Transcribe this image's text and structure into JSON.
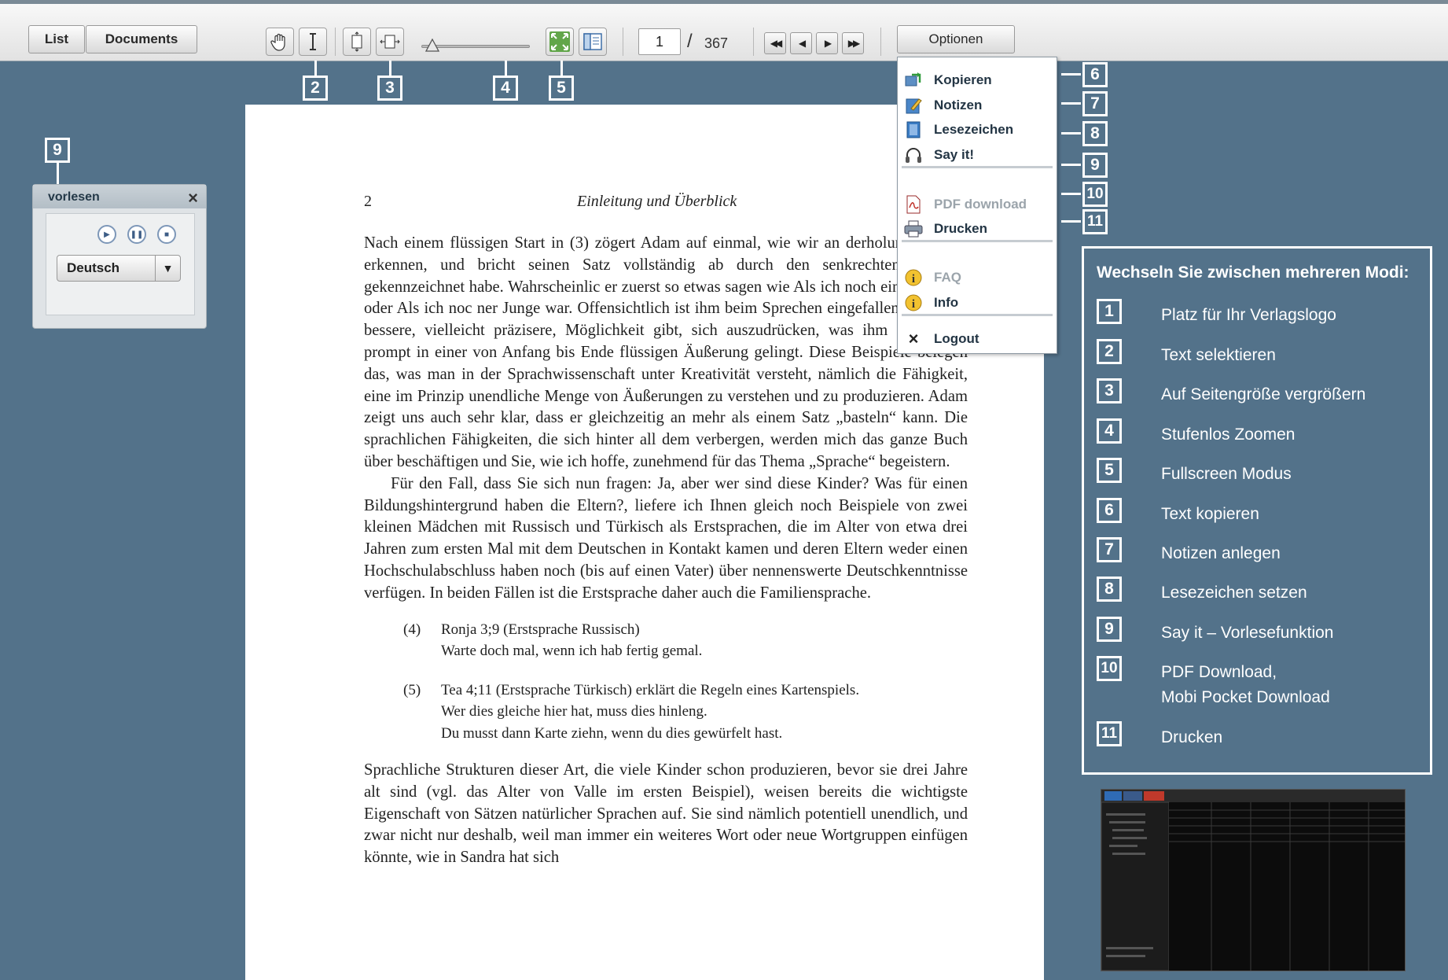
{
  "toolbar": {
    "list_label": "List",
    "documents_label": "Documents",
    "current_page": "1",
    "page_separator": "/",
    "total_pages": "367",
    "options_label": "Optionen"
  },
  "callouts": [
    "2",
    "3",
    "4",
    "5",
    "6",
    "7",
    "8",
    "9",
    "10",
    "11",
    "9"
  ],
  "vorlesen": {
    "title": "vorlesen",
    "language": "Deutsch"
  },
  "menu": {
    "items": [
      {
        "label": "Kopieren",
        "icon": "copy-icon"
      },
      {
        "label": "Notizen",
        "icon": "notes-icon"
      },
      {
        "label": "Lesezeichen",
        "icon": "bookmark-icon"
      },
      {
        "label": "Say it!",
        "icon": "headphones-icon"
      },
      {
        "label": "PDF download",
        "icon": "pdf-icon",
        "disabled": true
      },
      {
        "label": "Drucken",
        "icon": "print-icon"
      },
      {
        "label": "FAQ",
        "icon": "info-icon",
        "disabled": true
      },
      {
        "label": "Info",
        "icon": "info-icon"
      },
      {
        "label": "Logout",
        "icon": "close-icon"
      }
    ]
  },
  "document": {
    "page_number": "2",
    "running_head": "Einleitung und Überblick",
    "para1": "Nach einem flüssigen Start in (3) zögert Adam auf einmal, wie wir an derholung von ein erkennen, und bricht seinen Satz vollständig ab durch den senkrechten Strich | gekennzeichnet habe. Wahrscheinlic er zuerst so etwas sagen wie Als ich noch ein Baby war oder Als ich noc ner Junge war. Offensichtlich ist ihm beim Sprechen eingefallen, dass eine bessere, vielleicht präzisere, Möglichkeit gibt, sich auszudrücken, was ihm dann auch prompt in einer von Anfang bis Ende flüssigen Äußerung gelingt. Diese Beispiele belegen das, was man in der Sprachwissenschaft unter Kreativität versteht, nämlich die Fähigkeit, eine im Prinzip unendliche Menge von Äußerungen zu verstehen und zu produzieren. Adam zeigt uns auch sehr klar, dass er gleichzeitig an mehr als einem Satz „basteln“ kann. Die sprachlichen Fähigkeiten, die sich hinter all dem verbergen, werden mich das ganze Buch über beschäftigen und Sie, wie ich hoffe, zunehmend für das Thema „Sprache“ begeistern.",
    "para2": "Für den Fall, dass Sie sich nun fragen: Ja, aber wer sind diese Kinder? Was für einen Bildungshintergrund haben die Eltern?, liefere ich Ihnen gleich noch Beispiele von zwei kleinen Mädchen mit Russisch und Türkisch als Erstsprachen, die im Alter von etwa drei Jahren zum ersten Mal mit dem Deutschen in Kontakt kamen und deren Eltern weder einen Hochschulabschluss haben noch (bis auf einen Vater) über nennenswerte Deutschkenntnisse verfügen. In beiden Fällen ist die Erstsprache daher auch die Familiensprache.",
    "ex4_num": "(4)",
    "ex4_head": "Ronja 3;9 (Erstsprache Russisch)",
    "ex4_line1": "Warte doch mal, wenn ich hab fertig gemal.",
    "ex5_num": "(5)",
    "ex5_head": "Tea 4;11 (Erstsprache Türkisch) erklärt die Regeln eines Kartenspiels.",
    "ex5_line1": "Wer dies gleiche hier hat, muss dies hinleng.",
    "ex5_line2": "Du musst dann Karte ziehn, wenn du dies gewürfelt hast.",
    "para3": "Sprachliche Strukturen dieser Art, die viele Kinder schon produzieren, bevor sie drei Jahre alt sind (vgl. das Alter von Valle im ersten Beispiel), weisen bereits die wichtigste Eigenschaft von Sätzen natürlicher Sprachen auf. Sie sind nämlich potentiell unendlich, und zwar nicht nur deshalb, weil man immer ein weiteres Wort oder neue Wortgruppen einfügen könnte, wie in Sandra hat sich"
  },
  "legend": {
    "title": "Wechseln Sie zwischen mehreren Modi:",
    "items": [
      {
        "num": "1",
        "text": "Platz für Ihr Verlagslogo"
      },
      {
        "num": "2",
        "text": "Text selektieren"
      },
      {
        "num": "3",
        "text": "Auf Seitengröße vergrößern"
      },
      {
        "num": "4",
        "text": "Stufenlos Zoomen"
      },
      {
        "num": "5",
        "text": "Fullscreen Modus"
      },
      {
        "num": "6",
        "text": "Text kopieren"
      },
      {
        "num": "7",
        "text": "Notizen anlegen"
      },
      {
        "num": "8",
        "text": "Lesezeichen setzen"
      },
      {
        "num": "9",
        "text": "Say it – Vorlesefunktion"
      },
      {
        "num": "10",
        "text": "PDF Download,",
        "text2": "Mobi Pocket Download"
      },
      {
        "num": "11",
        "text": "Drucken"
      }
    ]
  },
  "colors": {
    "background": "#53728a",
    "accent_text": "#233544"
  }
}
